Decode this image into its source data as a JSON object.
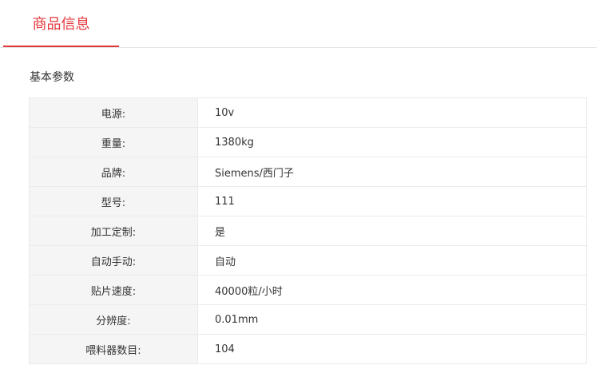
{
  "tabs": {
    "active_label": "商品信息"
  },
  "section": {
    "title": "基本参数"
  },
  "params": [
    {
      "label": "电源:",
      "value": "10v"
    },
    {
      "label": "重量:",
      "value": "1380kg"
    },
    {
      "label": "品牌:",
      "value": "Siemens/西门子"
    },
    {
      "label": "型号:",
      "value": "111"
    },
    {
      "label": "加工定制:",
      "value": "是"
    },
    {
      "label": "自动手动:",
      "value": "自动"
    },
    {
      "label": "贴片速度:",
      "value": "40000粒/小时"
    },
    {
      "label": "分辨度:",
      "value": "0.01mm"
    },
    {
      "label": "喂料器数目:",
      "value": "104"
    }
  ],
  "colors": {
    "accent": "#e4393c",
    "label_bg": "#f5f5f5",
    "border": "#ebebeb",
    "text": "#333333"
  }
}
